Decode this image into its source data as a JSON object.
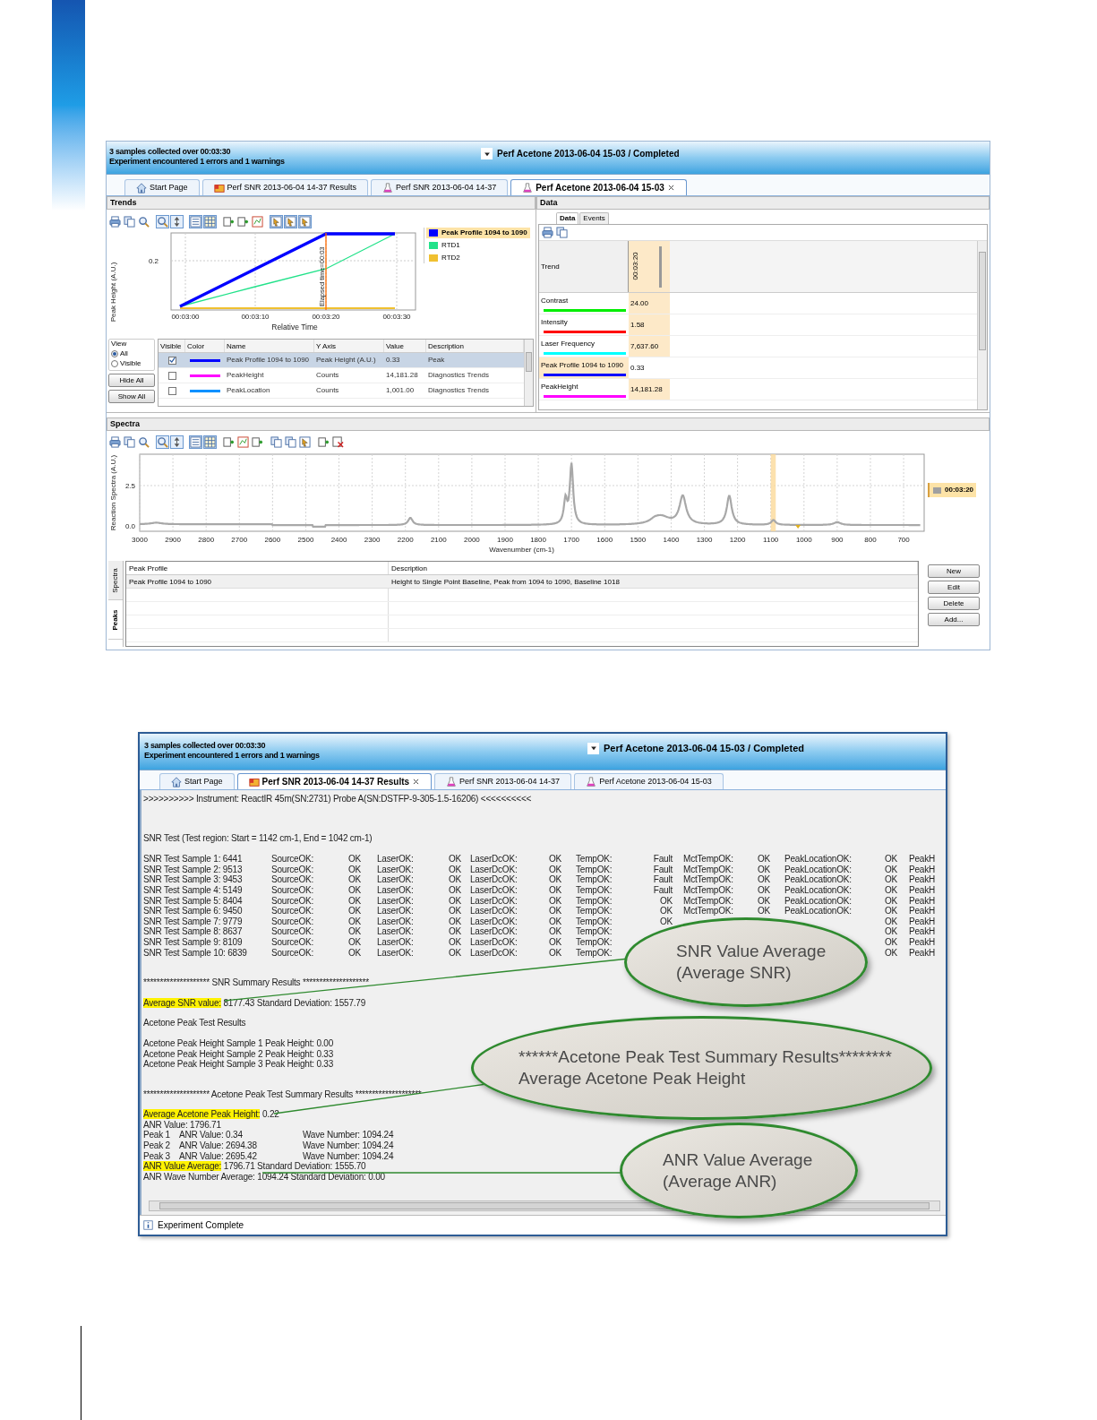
{
  "top_window": {
    "header": {
      "status_lines": [
        "3 samples collected over 00:03:30",
        "Experiment encountered 1 errors and 1 warnings"
      ],
      "experiment_title": "Perf Acetone 2013-06-04 15-03 / Completed"
    },
    "tabs": [
      {
        "kind": "start",
        "label": "Start Page",
        "selected": false,
        "closable": false
      },
      {
        "kind": "results",
        "label": "Perf SNR 2013-06-04 14-37 Results",
        "selected": false,
        "closable": false
      },
      {
        "kind": "experiment",
        "label": "Perf SNR 2013-06-04 14-37",
        "selected": false,
        "closable": false
      },
      {
        "kind": "experiment",
        "label": "Perf Acetone 2013-06-04 15-03",
        "selected": true,
        "closable": true
      }
    ],
    "trends": {
      "title": "Trends",
      "chart": {
        "y_label": "Peak Height (A.U.)",
        "y_tick": "0.2",
        "x_ticks": [
          "00:03:00",
          "00:03:10",
          "00:03:20",
          "00:03:30"
        ],
        "x_label": "Relative Time",
        "marker_label": "Elapsed time=00:03"
      },
      "legend": [
        {
          "label": "Peak Profile 1094 to 1090",
          "color": "#0000ff",
          "selected": true
        },
        {
          "label": "RTD1",
          "color": "#22e28a",
          "selected": false
        },
        {
          "label": "RTD2",
          "color": "#f0c030",
          "selected": false
        }
      ],
      "view": {
        "title": "View",
        "options": [
          {
            "label": "All",
            "selected": true
          },
          {
            "label": "Visible",
            "selected": false
          }
        ],
        "buttons": [
          "Hide All",
          "Show All"
        ]
      },
      "table": {
        "columns": [
          "Visible",
          "Color",
          "Name",
          "Y Axis",
          "Value",
          "Description"
        ],
        "rows": [
          {
            "visible": true,
            "color": "#0000ff",
            "selected": true,
            "cells": [
              "",
              "",
              "Peak Profile 1094 to 1090",
              "Peak Height (A.U.)",
              "0.33",
              "Peak"
            ]
          },
          {
            "visible": false,
            "color": "#ff00ff",
            "selected": false,
            "cells": [
              "",
              "",
              "PeakHeight",
              "Counts",
              "14,181.28",
              "Diagnostics Trends"
            ]
          },
          {
            "visible": false,
            "color": "#0090ff",
            "selected": false,
            "cells": [
              "",
              "",
              "PeakLocation",
              "Counts",
              "1,001.00",
              "Diagnostics Trends"
            ]
          }
        ]
      }
    },
    "data": {
      "title": "Data",
      "subtabs": [
        {
          "label": "Data",
          "selected": true
        },
        {
          "label": "Events",
          "selected": false
        }
      ],
      "header": "Trend",
      "time": "00:03:20",
      "rows": [
        {
          "label": "Contrast",
          "color": "#00ee00",
          "value": "24.00",
          "selected": false
        },
        {
          "label": "Intensity",
          "color": "#ff0000",
          "value": "1.58",
          "selected": false
        },
        {
          "label": "Laser Frequency",
          "color": "#00ffff",
          "value": "7,637.60",
          "selected": false
        },
        {
          "label": "Peak Profile 1094 to 1090",
          "color": "#0000ff",
          "value": "0.33",
          "selected": true
        },
        {
          "label": "PeakHeight",
          "color": "#ff00ff",
          "value": "14,181.28",
          "selected": false
        }
      ]
    },
    "spectra": {
      "title": "Spectra",
      "chart": {
        "y_label": "Reaction Spectra (A.U.)",
        "y_ticks": [
          "2.5",
          "0.0"
        ],
        "x_ticks": [
          "3000",
          "2900",
          "2800",
          "2700",
          "2600",
          "2500",
          "2400",
          "2300",
          "2200",
          "2100",
          "2000",
          "1900",
          "1800",
          "1700",
          "1600",
          "1500",
          "1400",
          "1300",
          "1200",
          "1100",
          "1000",
          "900",
          "800",
          "700"
        ],
        "x_label": "Wavenumber (cm-1)"
      },
      "legend": "00:03:20",
      "side_tabs": [
        {
          "label": "Spectra",
          "selected": false
        },
        {
          "label": "Peaks",
          "selected": true
        }
      ],
      "peaks_table": {
        "columns": [
          "Peak Profile",
          "Description"
        ],
        "rows": [
          [
            "Peak Profile 1094 to 1090",
            "Height to Single Point Baseline, Peak from 1094 to 1090, Baseline 1018"
          ]
        ]
      },
      "buttons": [
        "New",
        "Edit",
        "Delete",
        "Add..."
      ]
    }
  },
  "bottom_window": {
    "header": {
      "status_lines": [
        "3 samples collected over 00:03:30",
        "Experiment encountered 1 errors and 1 warnings"
      ],
      "experiment_title": "Perf Acetone 2013-06-04 15-03 / Completed"
    },
    "tabs": [
      {
        "kind": "start",
        "label": "Start Page",
        "selected": false,
        "closable": false
      },
      {
        "kind": "results",
        "label": "Perf SNR 2013-06-04 14-37 Results",
        "selected": true,
        "closable": true
      },
      {
        "kind": "experiment",
        "label": "Perf SNR 2013-06-04 14-37",
        "selected": false,
        "closable": false
      },
      {
        "kind": "experiment",
        "label": "Perf Acetone 2013-06-04 15-03",
        "selected": false,
        "closable": false
      }
    ],
    "instrument_line": ">>>>>>>>>> Instrument: ReactIR 45m(SN:2731) Probe A(SN:DSTFP-9-305-1.5-16206) <<<<<<<<<<",
    "snr_title": "SNR Test (Test region: Start = 1142 cm-1, End = 1042 cm-1)",
    "snr_rows": [
      [
        "SNR Test Sample 1: 6441",
        "SourceOK:",
        "OK",
        "LaserOK:",
        "OK",
        "LaserDcOK:",
        "OK",
        "TempOK:",
        "Fault",
        "MctTempOK:",
        "OK",
        "PeakLocationOK:",
        "OK",
        "PeakH"
      ],
      [
        "SNR Test Sample 2: 9513",
        "SourceOK:",
        "OK",
        "LaserOK:",
        "OK",
        "LaserDcOK:",
        "OK",
        "TempOK:",
        "Fault",
        "MctTempOK:",
        "OK",
        "PeakLocationOK:",
        "OK",
        "PeakH"
      ],
      [
        "SNR Test Sample 3: 9453",
        "SourceOK:",
        "OK",
        "LaserOK:",
        "OK",
        "LaserDcOK:",
        "OK",
        "TempOK:",
        "Fault",
        "MctTempOK:",
        "OK",
        "PeakLocationOK:",
        "OK",
        "PeakH"
      ],
      [
        "SNR Test Sample 4: 5149",
        "SourceOK:",
        "OK",
        "LaserOK:",
        "OK",
        "LaserDcOK:",
        "OK",
        "TempOK:",
        "Fault",
        "MctTempOK:",
        "OK",
        "PeakLocationOK:",
        "OK",
        "PeakH"
      ],
      [
        "SNR Test Sample 5: 8404",
        "SourceOK:",
        "OK",
        "LaserOK:",
        "OK",
        "LaserDcOK:",
        "OK",
        "TempOK:",
        "OK",
        "MctTempOK:",
        "OK",
        "PeakLocationOK:",
        "OK",
        "PeakH"
      ],
      [
        "SNR Test Sample 6: 9450",
        "SourceOK:",
        "OK",
        "LaserOK:",
        "OK",
        "LaserDcOK:",
        "OK",
        "TempOK:",
        "OK",
        "MctTempOK:",
        "OK",
        "PeakLocationOK:",
        "OK",
        "PeakH"
      ],
      [
        "SNR Test Sample 7: 9779",
        "SourceOK:",
        "OK",
        "LaserOK:",
        "OK",
        "LaserDcOK:",
        "OK",
        "TempOK:",
        "OK",
        null,
        null,
        null,
        "OK",
        "PeakH"
      ],
      [
        "SNR Test Sample 8: 8637",
        "SourceOK:",
        "OK",
        "LaserOK:",
        "OK",
        "LaserDcOK:",
        "OK",
        "TempOK:",
        null,
        null,
        null,
        null,
        "OK",
        "PeakH"
      ],
      [
        "SNR Test Sample 9: 8109",
        "SourceOK:",
        "OK",
        "LaserOK:",
        "OK",
        "LaserDcOK:",
        "OK",
        "TempOK:",
        null,
        null,
        null,
        null,
        "OK",
        "PeakH"
      ],
      [
        "SNR Test Sample 10: 6839",
        "SourceOK:",
        "OK",
        "LaserOK:",
        "OK",
        "LaserDcOK:",
        "OK",
        "TempOK:",
        null,
        null,
        null,
        null,
        "OK",
        "PeakH"
      ]
    ],
    "snr_summary_title": "******************** SNR Summary Results ********************",
    "snr_average": {
      "highlight": "Average SNR value:",
      "rest": " 8177.43  Standard Deviation: 1557.79"
    },
    "acetone_title": "Acetone Peak Test Results",
    "acetone_samples": [
      "Acetone Peak Height Sample 1 Peak Height: 0.00",
      "Acetone Peak Height Sample 2 Peak Height: 0.33",
      "Acetone Peak Height Sample 3 Peak Height: 0.33"
    ],
    "acetone_summary_title": "******************** Acetone Peak Test Summary Results ********************",
    "acetone_average": {
      "highlight": "Average Acetone Peak Height:",
      "rest": " 0.22"
    },
    "anr_value": "ANR Value: 1796.71",
    "peaks": [
      [
        "Peak 1",
        "ANR Value: 0.34",
        "Wave Number: 1094.24"
      ],
      [
        "Peak 2",
        "ANR Value: 2694.38",
        "Wave Number: 1094.24"
      ],
      [
        "Peak 3",
        "ANR Value: 2695.42",
        "Wave Number: 1094.24"
      ]
    ],
    "anr_average": {
      "highlight": "ANR Value Average:",
      "rest": " 1796.71   Standard Deviation: 1555.70"
    },
    "wave_average": "ANR Wave Number Average: 1094.24   Standard Deviation: 0.00",
    "status_bar": "Experiment Complete",
    "callouts": [
      {
        "lines": [
          "SNR Value Average",
          "(Average SNR)"
        ]
      },
      {
        "lines": [
          "******Acetone Peak Test Summary Results********",
          "Average Acetone Peak Height"
        ]
      },
      {
        "lines": [
          "ANR Value Average",
          "(Average ANR)"
        ]
      }
    ]
  }
}
